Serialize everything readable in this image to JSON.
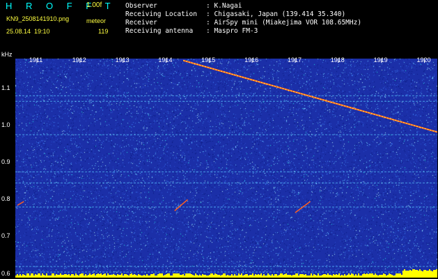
{
  "colors": {
    "background": "#000000",
    "title": "#00ffff",
    "header_text": "#ffffff",
    "axis_labels": "#ffffff",
    "spectrum_base": "#1b2fa8",
    "noise_hi": "#4ab0ff",
    "signal": "#ffff40",
    "meteor_echo": "#ff6020",
    "baseline_bar": "#ffff00"
  },
  "header": {
    "app_title": "H R O F F T",
    "version": "1.00f",
    "filename": "KN9_2508141910.png",
    "mode": "meteor",
    "datetime": "25.08.14  19:10",
    "count": "119",
    "info": [
      {
        "label": "Observer",
        "value": ": K.Nagai"
      },
      {
        "label": "Receiving Location",
        "value": ": Chigasaki, Japan (139.414 35.340)"
      },
      {
        "label": "Receiver",
        "value": ": AirSpy mini (Miakejima VOR 108.65MHz)"
      },
      {
        "label": "Receiving antenna",
        "value": ": Maspro FM-3"
      }
    ]
  },
  "chart_data": {
    "type": "heatmap",
    "unit": "kHz",
    "time_ticks": [
      "1911",
      "1912",
      "1913",
      "1914",
      "1915",
      "1916",
      "1917",
      "1918",
      "1919",
      "1920"
    ],
    "freq_ticks": [
      "1.1",
      "1.0",
      "0.9",
      "0.8",
      "0.7",
      "0.6"
    ],
    "x_range_minutes": [
      1910.5,
      1920.3
    ],
    "y_range_khz": [
      0.59,
      1.18
    ],
    "horizontal_carriers_khz": [
      1.08,
      1.065,
      0.975,
      0.875,
      0.845,
      0.78,
      0.62,
      0.605
    ],
    "doppler_trace": {
      "start": [
        1914.4,
        1.175
      ],
      "end": [
        1920.3,
        0.982
      ]
    },
    "meteor_echoes": [
      {
        "t_start": 1914.2,
        "t_end": 1914.5,
        "f_start": 0.77,
        "f_end": 0.8
      },
      {
        "t_start": 1917.0,
        "t_end": 1917.35,
        "f_start": 0.765,
        "f_end": 0.795
      },
      {
        "t_start": 1910.55,
        "t_end": 1910.7,
        "f_start": 0.785,
        "f_end": 0.795
      }
    ]
  }
}
